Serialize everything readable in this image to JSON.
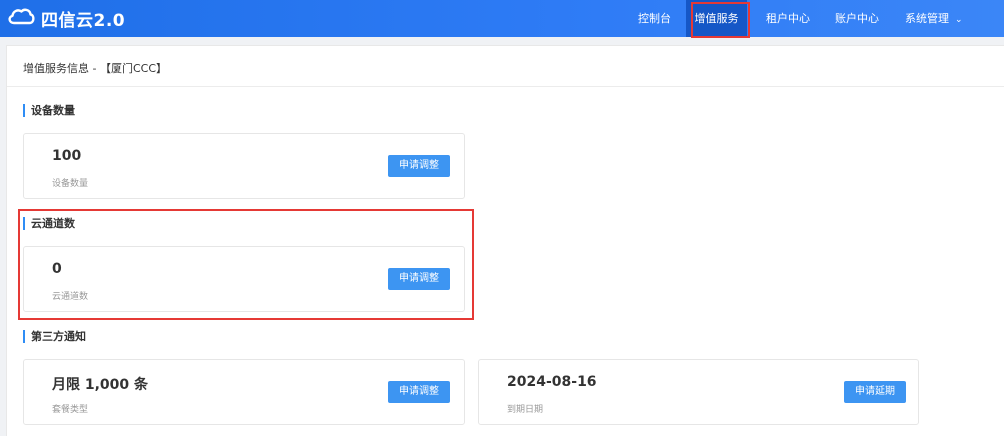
{
  "app": {
    "brand": "四信云2.0"
  },
  "nav": {
    "items": [
      {
        "label": "控制台"
      },
      {
        "label": "增值服务"
      },
      {
        "label": "租户中心"
      },
      {
        "label": "账户中心"
      },
      {
        "label": "系统管理"
      }
    ],
    "active": "增值服务",
    "caret": "⌄"
  },
  "page": {
    "title": "增值服务信息 - 【厦门CCC】"
  },
  "sections": {
    "devices": {
      "title": "设备数量",
      "value": "100",
      "label": "设备数量",
      "button": "申请调整"
    },
    "cloud_channels": {
      "title": "云通道数",
      "value": "0",
      "label": "云通道数",
      "button": "申请调整"
    },
    "third_party": {
      "title": "第三方通知",
      "package": {
        "value": "月限 1,000 条",
        "label": "套餐类型",
        "button": "申请调整"
      },
      "expiry": {
        "value": "2024-08-16",
        "label": "到期日期",
        "button": "申请延期"
      }
    }
  },
  "colors": {
    "header_gradient_start": "#1f6fe8",
    "header_active": "#1557c7",
    "button": "#3d95f2",
    "accent_bar": "#2f8df5",
    "highlight": "#e53935"
  }
}
